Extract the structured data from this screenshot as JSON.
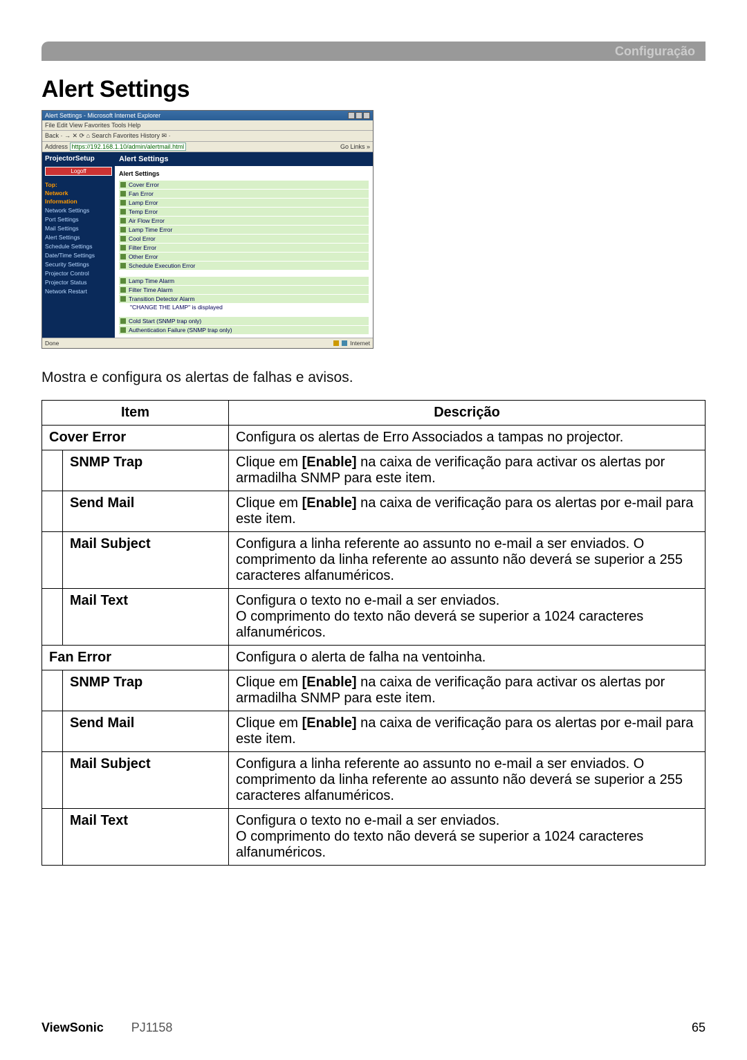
{
  "header": {
    "section": "Configuração"
  },
  "title": "Alert Settings",
  "intro": "Mostra e configura os alertas de falhas e avisos.",
  "screenshot": {
    "window_title": "Alert Settings - Microsoft Internet Explorer",
    "menubar": "File   Edit   View   Favorites   Tools   Help",
    "toolbar": "Back  ·  →   ✕  ⟳  ⌂   Search   Favorites   History   ✉  ·",
    "address_label": "Address",
    "address_value": "https://192.168.1.10/admin/alertmail.html",
    "address_right": "Go   Links »",
    "sidebar": {
      "brand": "ProjectorSetup",
      "logoff": "Logoff",
      "top_head": "Top:",
      "net_head": "Network",
      "info_head": "Information",
      "items": [
        "Network Settings",
        "Port Settings",
        "Mail Settings",
        "Alert Settings",
        "Schedule Settings",
        "Date/Time Settings",
        "Security Settings",
        "Projector Control",
        "Projector Status",
        "Network Restart"
      ]
    },
    "main": {
      "header": "Alert Settings",
      "subheader": "Alert Settings",
      "group1": [
        "Cover Error",
        "Fan Error",
        "Lamp Error",
        "Temp Error",
        "Air Flow Error",
        "Lamp Time Error",
        "Cool Error",
        "Filter Error",
        "Other Error",
        "Schedule Execution Error"
      ],
      "group2": [
        "Lamp Time Alarm",
        "Filter Time Alarm",
        "Transition Detector Alarm"
      ],
      "note": "\"CHANGE THE LAMP\" is displayed",
      "group3": [
        "Cold Start (SNMP trap only)",
        "Authentication Failure (SNMP trap only)"
      ]
    },
    "status_left": "Done",
    "status_right": "Internet"
  },
  "table": {
    "head_item": "Item",
    "head_desc": "Descrição",
    "rows": [
      {
        "type": "group",
        "item": "Cover Error",
        "desc": "Configura os alertas de Erro Associados a tampas no projector."
      },
      {
        "type": "sub",
        "item": "SNMP Trap",
        "desc_pre": "Clique em ",
        "desc_bold": "[Enable]",
        "desc_post": " na caixa de verificação para activar os alertas por armadilha SNMP para este item."
      },
      {
        "type": "sub",
        "item": "Send Mail",
        "desc_pre": "Clique em ",
        "desc_bold": "[Enable]",
        "desc_post": " na caixa de verificação para os alertas por e-mail para este item."
      },
      {
        "type": "sub",
        "item": "Mail Subject",
        "desc_plain": "Configura a linha referente ao assunto no e-mail a ser enviados. O comprimento da linha referente ao assunto não deverá se superior a 255 caracteres alfanuméricos."
      },
      {
        "type": "sub",
        "item": "Mail Text",
        "desc_plain": "Configura o texto no e-mail a ser enviados.\nO comprimento do texto não deverá se superior a 1024 caracteres alfanuméricos."
      },
      {
        "type": "group",
        "item": "Fan Error",
        "desc": "Configura o alerta de falha na ventoinha."
      },
      {
        "type": "sub",
        "item": "SNMP Trap",
        "desc_pre": "Clique em ",
        "desc_bold": "[Enable]",
        "desc_post": " na caixa de verificação para activar os alertas por armadilha SNMP para este item."
      },
      {
        "type": "sub",
        "item": "Send Mail",
        "desc_pre": "Clique em ",
        "desc_bold": "[Enable]",
        "desc_post": " na caixa de verificação para os alertas por e-mail para este item."
      },
      {
        "type": "sub",
        "item": "Mail Subject",
        "desc_plain": "Configura a linha referente ao assunto no e-mail a ser enviados. O comprimento da linha referente ao assunto não deverá se superior a 255 caracteres alfanuméricos."
      },
      {
        "type": "sub",
        "item": "Mail Text",
        "desc_plain": "Configura o texto no e-mail a ser enviados.\nO comprimento do texto não deverá se superior a 1024 caracteres alfanuméricos."
      }
    ]
  },
  "footer": {
    "brand": "ViewSonic",
    "model": "PJ1158",
    "page": "65"
  }
}
